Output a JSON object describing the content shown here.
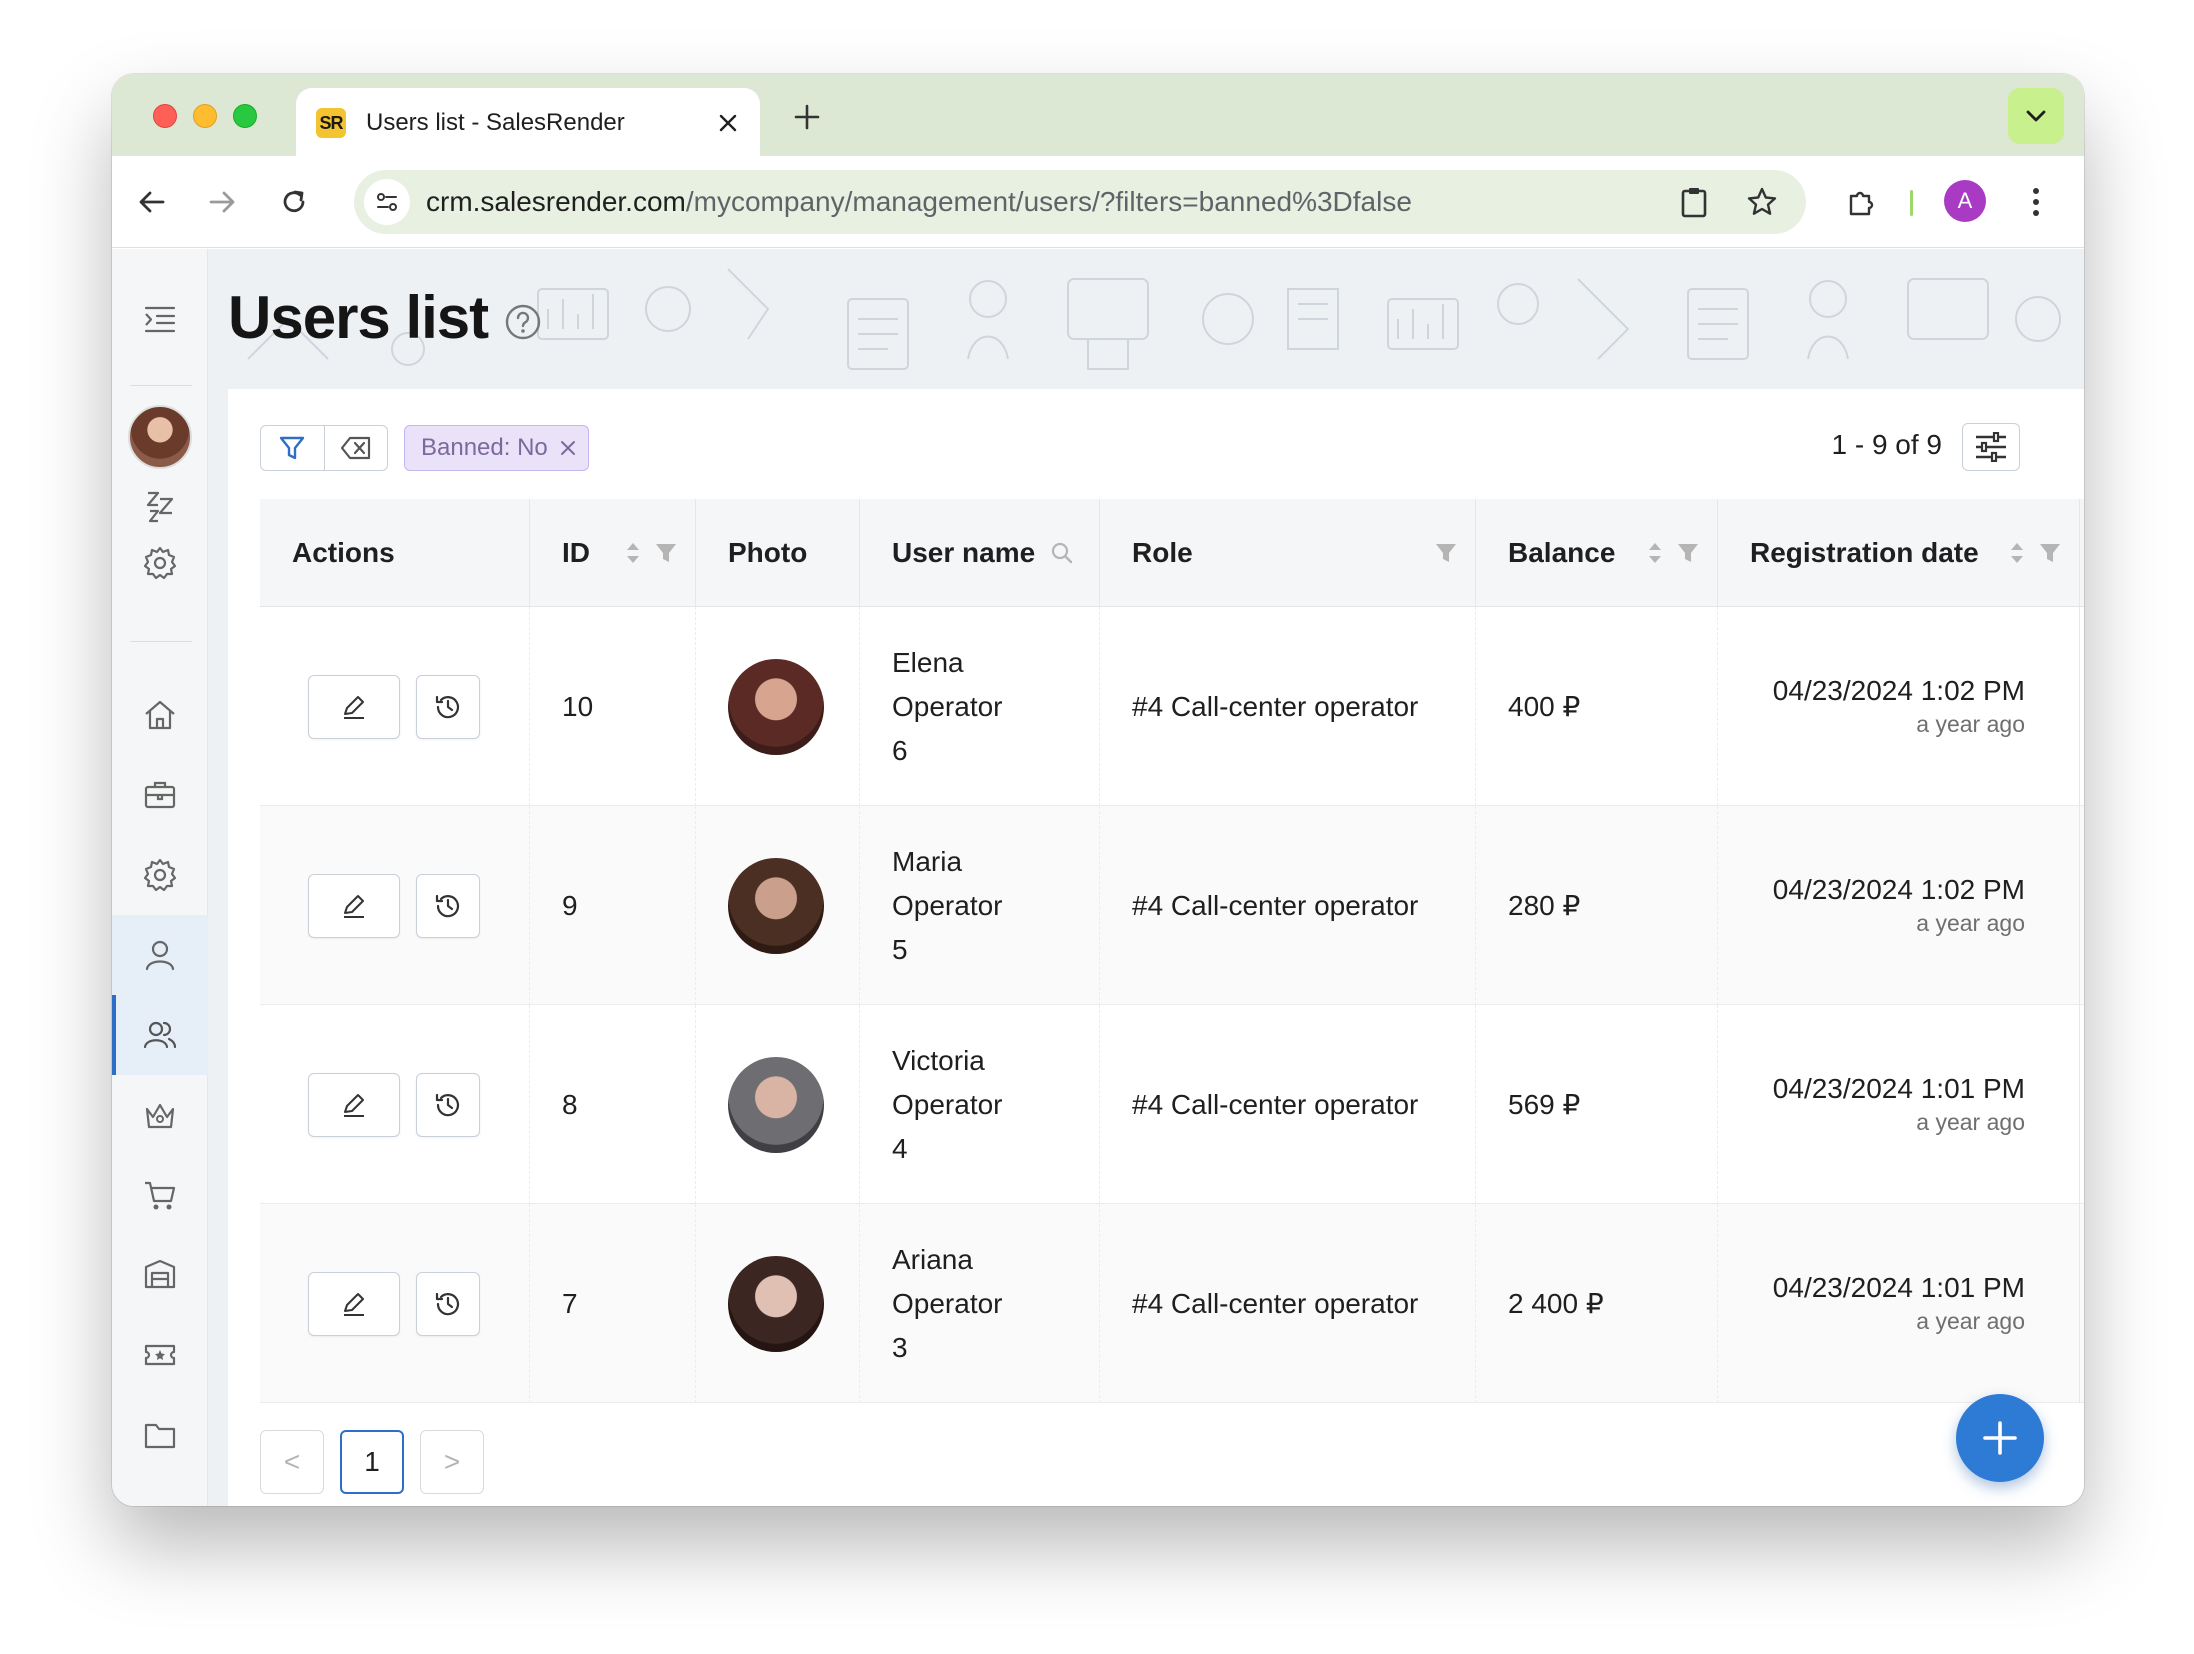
{
  "browser": {
    "tab_title": "Users list - SalesRender",
    "tab_favicon": "SR",
    "url_host": "crm.salesrender.com",
    "url_path": "/mycompany/management/users/?filters=banned%3Dfalse",
    "profile_initial": "A",
    "icons": [
      "back-icon",
      "forward-icon",
      "reload-icon",
      "site-info-icon",
      "clipboard-icon",
      "bookmark-star-icon",
      "extensions-icon",
      "kebab-menu-icon",
      "tab-search-icon",
      "new-tab-icon",
      "close-icon"
    ]
  },
  "sidebar": {
    "items": [
      "menu-toggle",
      "user-avatar",
      "sleep",
      "settings",
      "home",
      "briefcase",
      "settings-2",
      "user",
      "users",
      "crown",
      "cart",
      "warehouse",
      "ticket",
      "folder"
    ],
    "active_item": "users"
  },
  "page": {
    "title": "Users list",
    "filter_chip": "Banned: No",
    "count_text": "1 - 9 of 9"
  },
  "table": {
    "columns": [
      "Actions",
      "ID",
      "Photo",
      "User name",
      "Role",
      "Balance",
      "Registration date"
    ],
    "rows": [
      {
        "id": "10",
        "name_1": "Elena",
        "name_2": "Operator",
        "name_3": "6",
        "role": "#4 Call-center operator",
        "balance": "400 ₽",
        "date": "04/23/2024 1:02 PM",
        "ago": "a year ago"
      },
      {
        "id": "9",
        "name_1": "Maria",
        "name_2": "Operator",
        "name_3": "5",
        "role": "#4 Call-center operator",
        "balance": "280 ₽",
        "date": "04/23/2024 1:02 PM",
        "ago": "a year ago"
      },
      {
        "id": "8",
        "name_1": "Victoria",
        "name_2": "Operator",
        "name_3": "4",
        "role": "#4 Call-center operator",
        "balance": "569 ₽",
        "date": "04/23/2024 1:01 PM",
        "ago": "a year ago"
      },
      {
        "id": "7",
        "name_1": "Ariana",
        "name_2": "Operator",
        "name_3": "3",
        "role": "#4 Call-center operator",
        "balance": "2 400 ₽",
        "date": "04/23/2024 1:01 PM",
        "ago": "a year ago"
      }
    ]
  },
  "pagination": {
    "current_page": "1",
    "prev": "<",
    "next": ">"
  },
  "colors": {
    "accent": "#2e6fc6",
    "fab": "#2e7bd6",
    "chip_bg": "#e9e2f8",
    "tabbar": "#dce8d4"
  }
}
